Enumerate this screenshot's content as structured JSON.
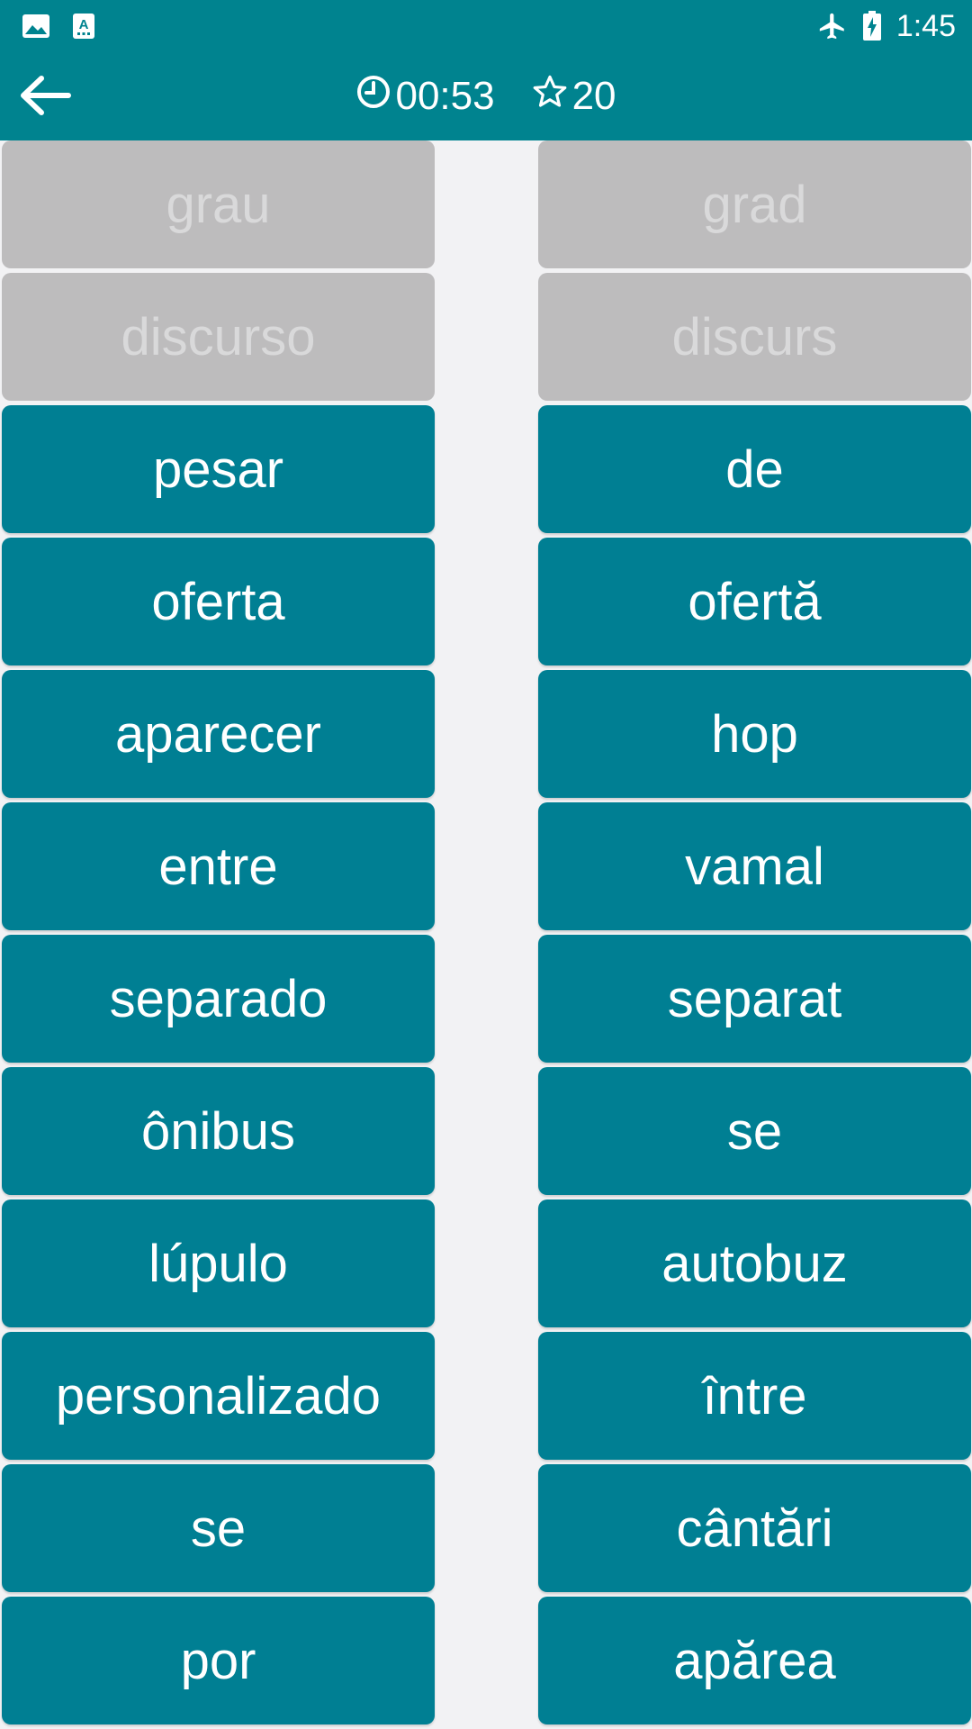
{
  "status_bar": {
    "time": "1:45",
    "icons": [
      "image-icon",
      "app-store-icon",
      "airplane-icon",
      "battery-charging-icon"
    ]
  },
  "app_bar": {
    "timer": "00:53",
    "score": "20",
    "icons": [
      "back-arrow-icon",
      "clock-icon",
      "star-icon"
    ]
  },
  "colors": {
    "primary": "#00838f",
    "tile": "#007f93",
    "tile_done": "#bdbcbd",
    "tile_done_text": "#d9d9da",
    "background": "#f2f2f4"
  },
  "left_words": [
    {
      "text": "grau",
      "matched": true
    },
    {
      "text": "discurso",
      "matched": true
    },
    {
      "text": "pesar",
      "matched": false
    },
    {
      "text": "oferta",
      "matched": false
    },
    {
      "text": "aparecer",
      "matched": false
    },
    {
      "text": "entre",
      "matched": false
    },
    {
      "text": "separado",
      "matched": false
    },
    {
      "text": "ônibus",
      "matched": false
    },
    {
      "text": "lúpulo",
      "matched": false
    },
    {
      "text": "personalizado",
      "matched": false
    },
    {
      "text": "se",
      "matched": false
    },
    {
      "text": "por",
      "matched": false
    }
  ],
  "right_words": [
    {
      "text": "grad",
      "matched": true
    },
    {
      "text": "discurs",
      "matched": true
    },
    {
      "text": "de",
      "matched": false
    },
    {
      "text": "ofertă",
      "matched": false
    },
    {
      "text": "hop",
      "matched": false
    },
    {
      "text": "vamal",
      "matched": false
    },
    {
      "text": "separat",
      "matched": false
    },
    {
      "text": "se",
      "matched": false
    },
    {
      "text": "autobuz",
      "matched": false
    },
    {
      "text": "între",
      "matched": false
    },
    {
      "text": "cântări",
      "matched": false
    },
    {
      "text": "apărea",
      "matched": false
    }
  ]
}
